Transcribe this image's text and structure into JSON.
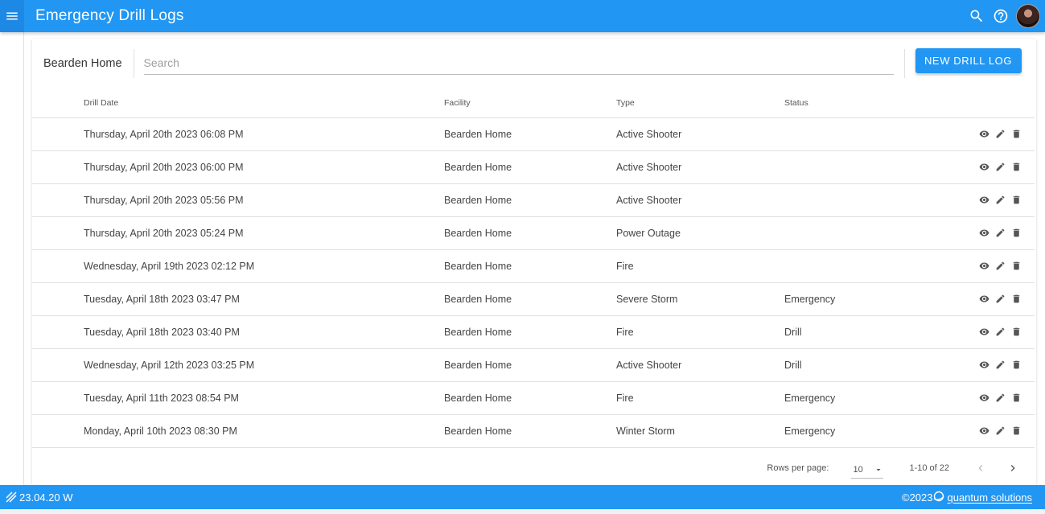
{
  "app": {
    "title": "Emergency Drill Logs"
  },
  "toolbar": {
    "facility": "Bearden Home",
    "search_placeholder": "Search",
    "search_value": "",
    "new_button_label": "NEW DRILL LOG"
  },
  "table": {
    "headers": {
      "date": "Drill Date",
      "facility": "Facility",
      "type": "Type",
      "status": "Status"
    },
    "rows": [
      {
        "date": "Thursday, April 20th 2023 06:08 PM",
        "facility": "Bearden Home",
        "type": "Active Shooter",
        "status": ""
      },
      {
        "date": "Thursday, April 20th 2023 06:00 PM",
        "facility": "Bearden Home",
        "type": "Active Shooter",
        "status": ""
      },
      {
        "date": "Thursday, April 20th 2023 05:56 PM",
        "facility": "Bearden Home",
        "type": "Active Shooter",
        "status": ""
      },
      {
        "date": "Thursday, April 20th 2023 05:24 PM",
        "facility": "Bearden Home",
        "type": "Power Outage",
        "status": ""
      },
      {
        "date": "Wednesday, April 19th 2023 02:12 PM",
        "facility": "Bearden Home",
        "type": "Fire",
        "status": ""
      },
      {
        "date": "Tuesday, April 18th 2023 03:47 PM",
        "facility": "Bearden Home",
        "type": "Severe Storm",
        "status": "Emergency"
      },
      {
        "date": "Tuesday, April 18th 2023 03:40 PM",
        "facility": "Bearden Home",
        "type": "Fire",
        "status": "Drill"
      },
      {
        "date": "Wednesday, April 12th 2023 03:25 PM",
        "facility": "Bearden Home",
        "type": "Active Shooter",
        "status": "Drill"
      },
      {
        "date": "Tuesday, April 11th 2023 08:54 PM",
        "facility": "Bearden Home",
        "type": "Fire",
        "status": "Emergency"
      },
      {
        "date": "Monday, April 10th 2023 08:30 PM",
        "facility": "Bearden Home",
        "type": "Winter Storm",
        "status": "Emergency"
      }
    ],
    "row_actions": [
      "eye-icon",
      "pencil-icon",
      "trash-icon"
    ]
  },
  "pagination": {
    "rows_per_page_label": "Rows per page:",
    "rows_per_page_value": "10",
    "range": "1-10 of 22"
  },
  "footer": {
    "version": "23.04.20 W",
    "copyright": "©2023",
    "brand": "quantum solutions"
  },
  "colors": {
    "primary": "#2196f3",
    "text": "#333333",
    "divider": "#e0e0e0"
  },
  "icons": {
    "menu": "menu-icon",
    "search": "search-icon",
    "help": "help-icon",
    "avatar": "avatar"
  }
}
